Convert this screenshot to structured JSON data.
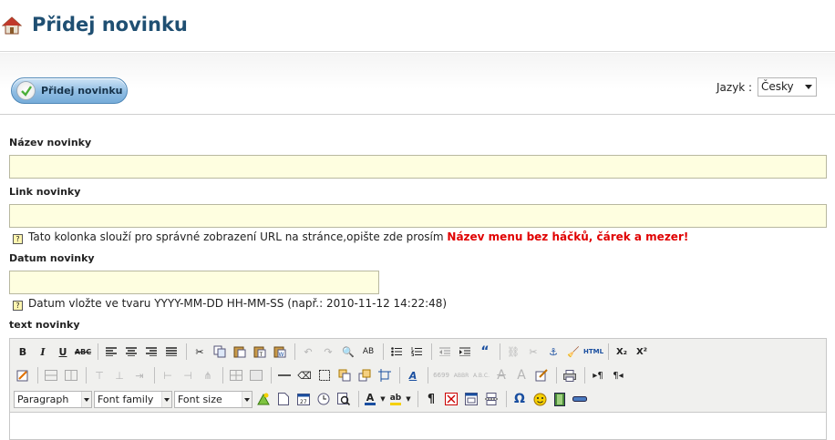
{
  "header": {
    "title": "Přidej novinku"
  },
  "actions": {
    "submit_label": "Přidej novinku"
  },
  "language": {
    "label": "Jazyk :",
    "selected": "Česky"
  },
  "fields": {
    "name": {
      "label": "Název novinky",
      "value": ""
    },
    "link": {
      "label": "Link novinky",
      "value": "",
      "hint": "Tato kolonka slouží pro správné zobrazení URL na stránce,opište zde prosím",
      "hint_warning": "Název menu bez háčků, čárek a mezer!"
    },
    "date": {
      "label": "Datum novinky",
      "value": "",
      "hint": "Datum vložte ve tvaru YYYY-MM-DD HH-MM-SS (např.: 2010-11-12 14:22:48)"
    },
    "text": {
      "label": "text novinky"
    }
  },
  "editor": {
    "format_select": "Paragraph",
    "font_family_select": "Font family",
    "font_size_select": "Font size",
    "buttons": {
      "bold": "B",
      "italic": "I",
      "underline": "U",
      "strike": "ABC",
      "subscript": "X₂",
      "superscript": "X²",
      "quote": "“",
      "html": "HTML",
      "omega": "Ω",
      "pilcrow": "¶"
    }
  },
  "colors": {
    "title": "#1f4f72",
    "input_bg": "#fefee0",
    "warning": "#e00000"
  }
}
